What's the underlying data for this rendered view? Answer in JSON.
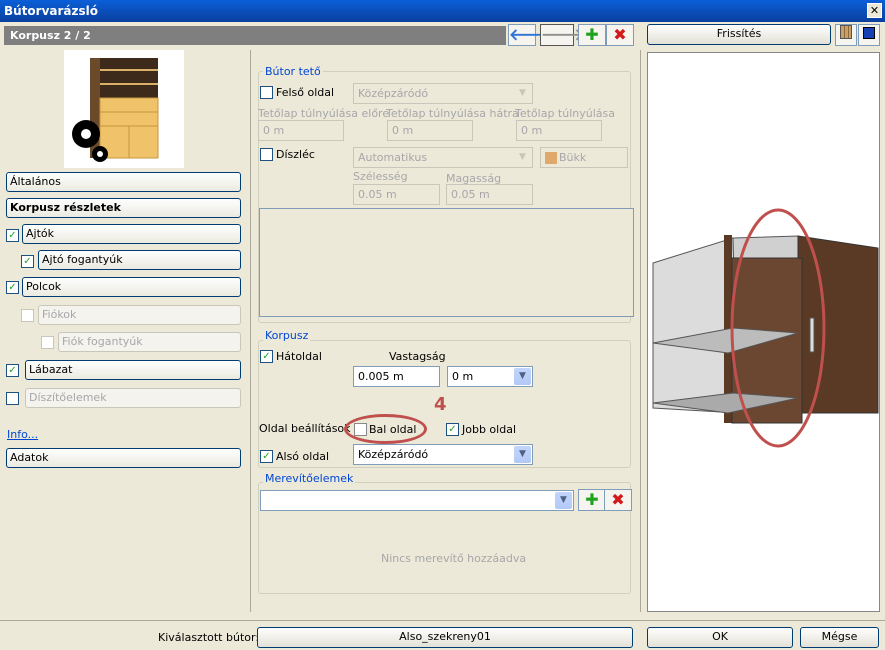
{
  "window": {
    "title": "Bútorvarázsló"
  },
  "header": {
    "title": "Korpusz 2 / 2"
  },
  "toolbar": {
    "back": "🡐",
    "forward": "🡒",
    "add": "✚",
    "delete": "✖"
  },
  "nav": {
    "general": "Általános",
    "body_details": "Korpusz részletek",
    "doors": "Ajtók",
    "door_handles": "Ajtó fogantyúk",
    "shelves": "Polcok",
    "drawers": "Fiókok",
    "drawer_handles": "Fiók fogantyúk",
    "plinth": "Lábazat",
    "decor": "Díszítőelemek",
    "info": "Info...",
    "data": "Adatok"
  },
  "top_group": {
    "legend": "Bútor tető",
    "top_side": "Felső oldal",
    "top_combo": "Középzáródó",
    "overhang_front": "Tetőlap túlnyúlása előre",
    "overhang_back": "Tetőlap túlnyúlása hátra",
    "overhang_side": "Tetőlap túlnyúlása",
    "val_front": "0 m",
    "val_back": "0 m",
    "val_side": "0 m",
    "decor_strip": "Díszléc",
    "decor_combo": "Automatikus",
    "material": "Bükk",
    "width_lbl": "Szélesség",
    "height_lbl": "Magasság",
    "width_val": "0.05 m",
    "height_val": "0.05 m"
  },
  "body_group": {
    "legend": "Korpusz",
    "back_side": "Hátoldal",
    "thickness_lbl": "Vastagság",
    "thickness_val": "0.005 m",
    "offset_val": "0 m",
    "side_settings": "Oldal beállítások",
    "left_side": "Bal oldal",
    "right_side": "Jobb oldal",
    "bottom_side": "Alsó oldal",
    "bottom_combo": "Középzáródó",
    "annotation": "4"
  },
  "brace_group": {
    "legend": "Merevítőelemek",
    "empty": "Nincs merevítő hozzáadva"
  },
  "preview": {
    "refresh": "Frissítés"
  },
  "footer": {
    "selected_lbl": "Kiválasztott bútor:",
    "selected_val": "Also_szekreny01",
    "ok": "OK",
    "cancel": "Mégse"
  },
  "colors": {
    "accent": "#0046d5",
    "annotation": "#c0504d",
    "wood": "#5a3a24"
  }
}
